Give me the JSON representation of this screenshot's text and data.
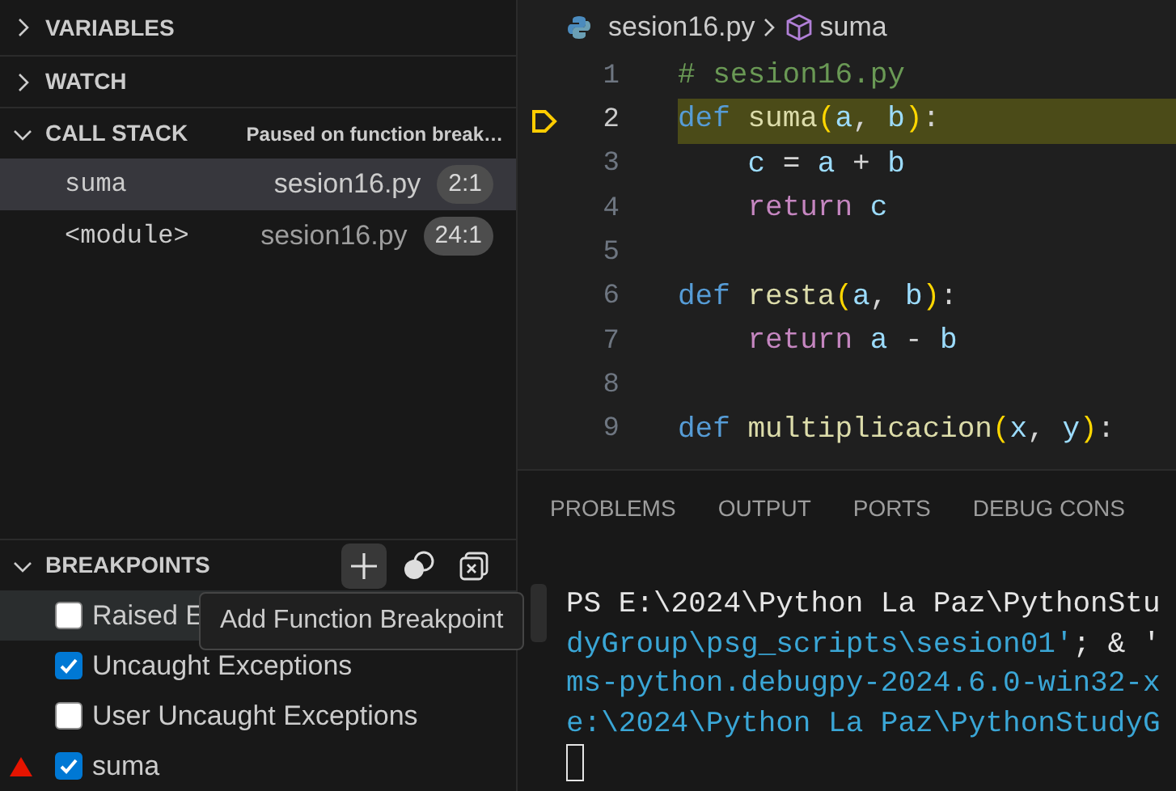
{
  "sidebar": {
    "sections": [
      {
        "title": "VARIABLES",
        "expanded": false
      },
      {
        "title": "WATCH",
        "expanded": false
      },
      {
        "title": "CALL STACK",
        "expanded": true,
        "status": "Paused on function break…"
      }
    ],
    "call_stack": [
      {
        "name": "suma",
        "file": "sesion16.py",
        "position": "2:1",
        "selected": true
      },
      {
        "name": "<module>",
        "file": "sesion16.py",
        "position": "24:1",
        "selected": false
      }
    ],
    "breakpoints": {
      "title": "BREAKPOINTS",
      "expanded": true,
      "items": [
        {
          "label": "Raised E",
          "checked": false,
          "selected": true,
          "function_breakpoint": false
        },
        {
          "label": "Uncaught Exceptions",
          "checked": true,
          "selected": false,
          "function_breakpoint": false
        },
        {
          "label": "User Uncaught Exceptions",
          "checked": false,
          "selected": false,
          "function_breakpoint": false
        },
        {
          "label": "suma",
          "checked": true,
          "selected": false,
          "function_breakpoint": true
        }
      ]
    },
    "tooltip": "Add Function Breakpoint"
  },
  "editor": {
    "breadcrumb": [
      "sesion16.py",
      "suma"
    ],
    "lines": [
      {
        "number": "1",
        "current": false,
        "tokens": [
          {
            "kind": "comment",
            "text": "# sesion16.py"
          }
        ]
      },
      {
        "number": "2",
        "current": true,
        "tokens": [
          {
            "kind": "keyword",
            "text": "def "
          },
          {
            "kind": "function",
            "text": "suma"
          },
          {
            "kind": "bracket",
            "text": "("
          },
          {
            "kind": "variable",
            "text": "a"
          },
          {
            "kind": "plain",
            "text": ", "
          },
          {
            "kind": "variable",
            "text": "b"
          },
          {
            "kind": "bracket",
            "text": ")"
          },
          {
            "kind": "plain",
            "text": ":"
          }
        ]
      },
      {
        "number": "3",
        "current": false,
        "tokens": [
          {
            "kind": "variable",
            "text": "    c"
          },
          {
            "kind": "plain",
            "text": " = "
          },
          {
            "kind": "variable",
            "text": "a"
          },
          {
            "kind": "plain",
            "text": " + "
          },
          {
            "kind": "variable",
            "text": "b"
          }
        ]
      },
      {
        "number": "4",
        "current": false,
        "tokens": [
          {
            "kind": "control",
            "text": "    return"
          },
          {
            "kind": "variable",
            "text": " c"
          }
        ]
      },
      {
        "number": "5",
        "current": false
      },
      {
        "number": "6",
        "current": false,
        "tokens": [
          {
            "kind": "keyword",
            "text": "def "
          },
          {
            "kind": "function",
            "text": "resta"
          },
          {
            "kind": "bracket",
            "text": "("
          },
          {
            "kind": "variable",
            "text": "a"
          },
          {
            "kind": "plain",
            "text": ", "
          },
          {
            "kind": "variable",
            "text": "b"
          },
          {
            "kind": "bracket",
            "text": ")"
          },
          {
            "kind": "plain",
            "text": ":"
          }
        ]
      },
      {
        "number": "7",
        "current": false,
        "tokens": [
          {
            "kind": "control",
            "text": "    return"
          },
          {
            "kind": "variable",
            "text": " a"
          },
          {
            "kind": "plain",
            "text": " - "
          },
          {
            "kind": "variable",
            "text": "b"
          }
        ]
      },
      {
        "number": "8",
        "current": false
      },
      {
        "number": "9",
        "current": false,
        "tokens": [
          {
            "kind": "keyword",
            "text": "def "
          },
          {
            "kind": "function",
            "text": "multiplicacion"
          },
          {
            "kind": "bracket",
            "text": "("
          },
          {
            "kind": "variable",
            "text": "x"
          },
          {
            "kind": "plain",
            "text": ", "
          },
          {
            "kind": "variable",
            "text": "y"
          },
          {
            "kind": "bracket",
            "text": ")"
          },
          {
            "kind": "plain",
            "text": ":"
          }
        ]
      }
    ]
  },
  "panel": {
    "tabs": [
      {
        "label": "PROBLEMS",
        "selected": false
      },
      {
        "label": "OUTPUT",
        "selected": false
      },
      {
        "label": "PORTS",
        "selected": false
      },
      {
        "label": "DEBUG CONS",
        "selected": false
      }
    ],
    "terminal": [
      [
        {
          "kind": "plain",
          "text": "PS E:\\2024\\Python La Paz\\PythonStu"
        }
      ],
      [
        {
          "kind": "path",
          "text": "dyGroup\\psg_scripts\\sesion01'"
        },
        {
          "kind": "plain",
          "text": "; & '"
        }
      ],
      [
        {
          "kind": "path",
          "text": "ms-python.debugpy-2024.6.0-win32-x"
        }
      ],
      [
        {
          "kind": "path",
          "text": "e:\\2024\\Python La Paz\\PythonStudyG"
        }
      ]
    ]
  }
}
